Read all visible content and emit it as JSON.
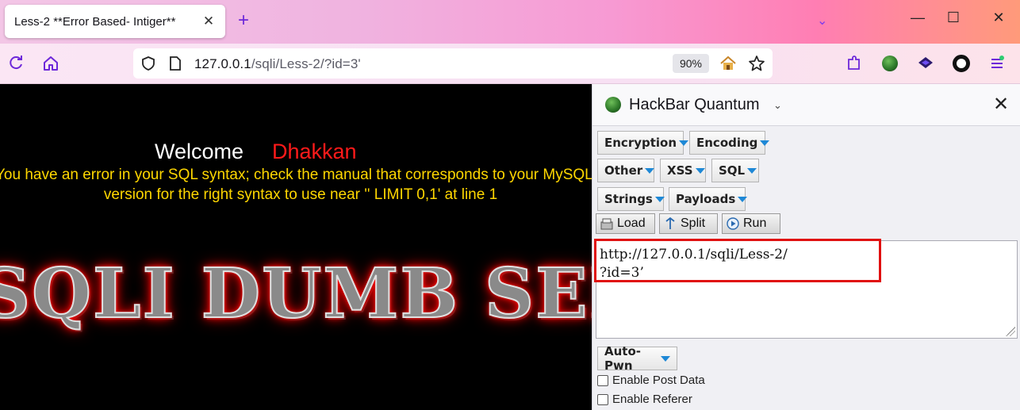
{
  "tab": {
    "title": "Less-2 **Error Based- Intiger**",
    "close": "✕"
  },
  "tabstrip": {
    "new_tab": "+",
    "list": "⌄",
    "minimize": "—",
    "maximize": "☐",
    "close": "✕"
  },
  "navbar": {
    "url_host": "127.0.0.1",
    "url_path": "/sqli/Less-2/?id=3'",
    "zoom": "90%"
  },
  "page": {
    "welcome": "Welcome",
    "user": "Dhakkan",
    "error_line1": "You have an error in your SQL syntax; check the manual that corresponds to your MySQL server",
    "error_line2": "version for the right syntax to use near '' LIMIT 0,1' at line 1",
    "banner": "SQLI DUMB SERIES"
  },
  "hackbar": {
    "title": "HackBar Quantum",
    "caret": "⌄",
    "close": "✕",
    "menus": {
      "encryption": "Encryption",
      "encoding": "Encoding",
      "other": "Other",
      "xss": "XSS",
      "sql": "SQL",
      "strings": "Strings",
      "payloads": "Payloads",
      "autopwn": "Auto-Pwn"
    },
    "actions": {
      "load": "Load",
      "split": "Split",
      "run": "Run"
    },
    "url_line1": "http://127.0.0.1/sqli/Less-2/",
    "url_line2": "?id=3’",
    "enable_post": "Enable Post Data",
    "enable_referer": "Enable Referer"
  },
  "colors": {
    "highlight": "#e01010",
    "user": "#ff1a1a",
    "error": "#ffd700"
  }
}
